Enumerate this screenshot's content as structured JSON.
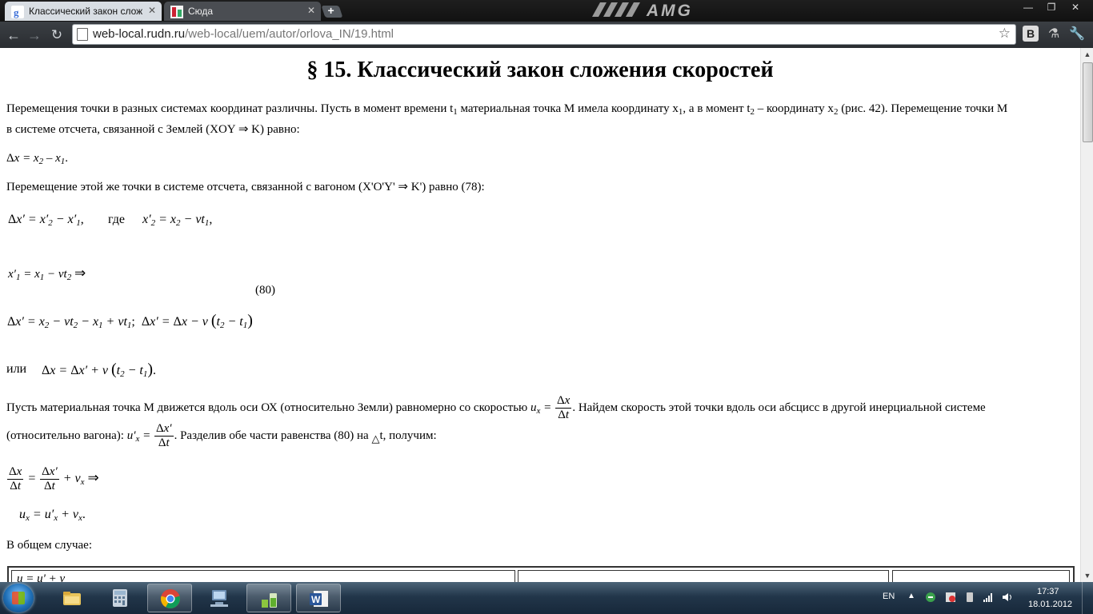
{
  "browser": {
    "tabs": [
      {
        "title": "Классический закон слож"
      },
      {
        "title": "Сюда"
      }
    ],
    "theme_text": "AMG",
    "url_host": "web-local.rudn.ru",
    "url_path": "/web-local/uem/autor/orlova_IN/19.html",
    "ext_label": "B",
    "window_controls": {
      "minimize": "—",
      "maximize": "❐",
      "close": "✕"
    }
  },
  "page": {
    "title": "§ 15. Классический закон сложения скоростей",
    "para1_a": "Перемещения точки в разных системах координат различны. Пусть в момент времени t",
    "para1_a_sub": "1",
    "para1_b": " материальная точка М имела координату x",
    "para1_b_sub": "1",
    "para1_c": ", а в момент t",
    "para1_c_sub": "2",
    "para1_d": " – координату x",
    "para1_d_sub": "2",
    "para1_e": " (рис. 42). Перемещение точки М",
    "para1_line2_a": "в системе отсчета, связанной с Землей (XOY ",
    "para1_line2_b": " K) равно:",
    "para2_a": "Перемещение этой же точки в системе отсчета, связанной с вагоном (X'O'Y' ",
    "para2_b": " K') равно (78):",
    "word_where": "где",
    "eq_number": "(80)",
    "word_or": "или",
    "para3_a": "Пусть материальная точка М движется вдоль оси ОХ (относительно Земли) равномерно со скоростью ",
    "para3_b": ". Найдем скорость этой точки вдоль оси абсцисс в другой инерциальной системе",
    "para4_a": "(относительно вагона): ",
    "para4_b": ". Разделив обе части равенства (80) на ",
    "para4_c": "t, получим:",
    "para5": "В общем случае:",
    "table_cell_1": "u = u' + v"
  },
  "taskbar": {
    "lang": "EN",
    "time": "17:37",
    "date": "18.01.2012"
  },
  "colors": {
    "chrome_frame": "#101010",
    "taskbar": "#22364a",
    "link_dim": "#777777"
  }
}
